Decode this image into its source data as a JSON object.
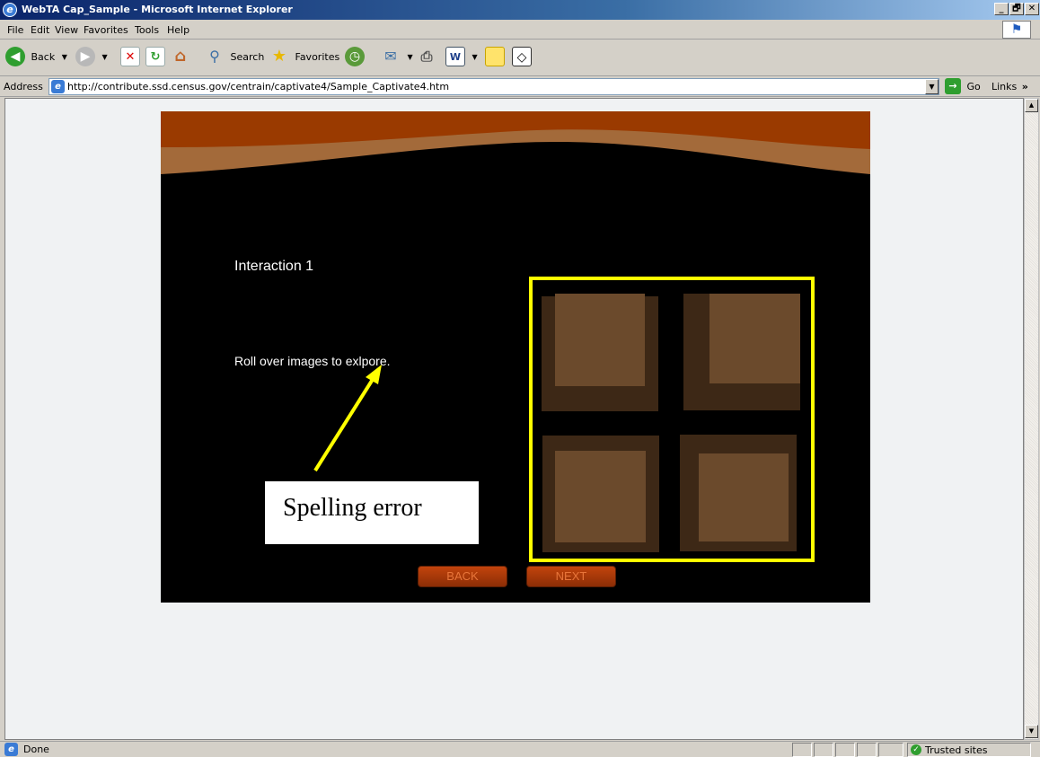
{
  "window": {
    "title": "WebTA Cap_Sample - Microsoft Internet Explorer",
    "buttons": [
      "_",
      "🗗",
      "✕"
    ]
  },
  "menu": [
    "File",
    "Edit",
    "View",
    "Favorites",
    "Tools",
    "Help"
  ],
  "toolbar": {
    "back_label": "Back",
    "search_label": "Search",
    "favorites_label": "Favorites"
  },
  "address": {
    "label": "Address",
    "url": "http://contribute.ssd.census.gov/centrain/captivate4/Sample_Captivate4.htm",
    "go_label": "Go",
    "links_label": "Links"
  },
  "movie": {
    "title": "Interaction 1",
    "instruction": "Roll over images to exlpore.",
    "callout": "Spelling error",
    "back_button": "BACK",
    "next_button": "NEXT",
    "colors": {
      "header_brown": "#9a3a00",
      "swoosh_tan": "#a36a3a",
      "tile_outer": "#3d2816",
      "tile_inner": "#6b4a2c",
      "highlight": "#ffff00",
      "arrow": "#ffff00"
    }
  },
  "status": {
    "text": "Done",
    "zone": "Trusted sites"
  }
}
